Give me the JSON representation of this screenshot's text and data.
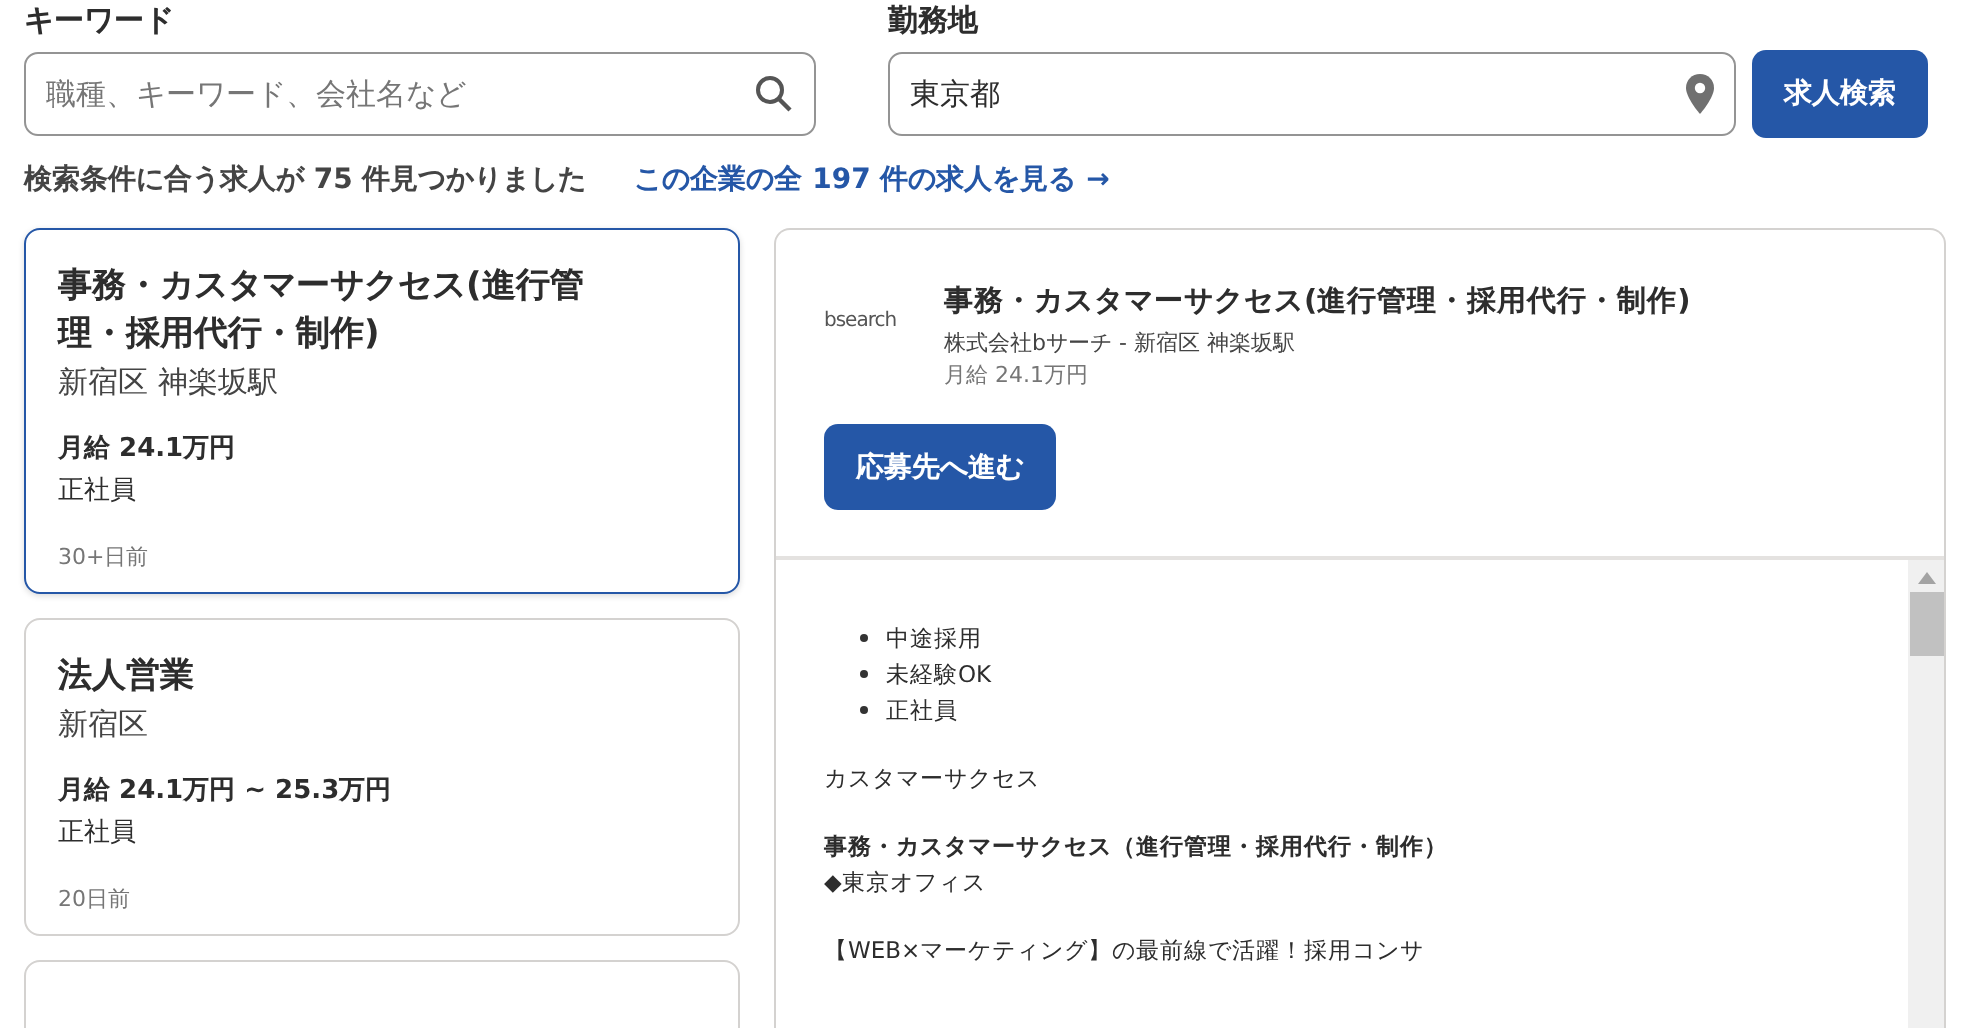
{
  "search": {
    "keyword": {
      "label": "キーワード",
      "placeholder": "職種、キーワード、会社名など"
    },
    "location": {
      "label": "勤務地",
      "value": "東京都"
    },
    "button": "求人検索"
  },
  "result_count": "検索条件に合う求人が 75 件見つかりました",
  "company_link": "この企業の全 197 件の求人を見る →",
  "jobs": [
    {
      "title": "事務・カスタマーサクセス(進行管理・採用代行・制作)",
      "location": "新宿区 神楽坂駅",
      "salary": "月給 24.1万円",
      "type": "正社員",
      "posted": "30+日前",
      "selected": true
    },
    {
      "title": "法人営業",
      "location": "新宿区",
      "salary": "月給 24.1万円 ~ 25.3万円",
      "type": "正社員",
      "posted": "20日前",
      "selected": false
    }
  ],
  "detail": {
    "logo": "bsearch",
    "title": "事務・カスタマーサクセス(進行管理・採用代行・制作)",
    "company": "株式会社bサーチ - 新宿区 神楽坂駅",
    "salary": "月給 24.1万円",
    "apply_button": "応募先へ進む",
    "tags": [
      "中途採用",
      "未経験OK",
      "正社員"
    ],
    "body": [
      {
        "kind": "text",
        "text": "カスタマーサクセス"
      },
      {
        "kind": "heading",
        "text": "事務・カスタマーサクセス（進行管理・採用代行・制作）"
      },
      {
        "kind": "line",
        "text": "◆東京オフィス"
      },
      {
        "kind": "text",
        "text": "【WEB×マーケティング】の最前線で活躍！採用コンサ"
      }
    ]
  }
}
